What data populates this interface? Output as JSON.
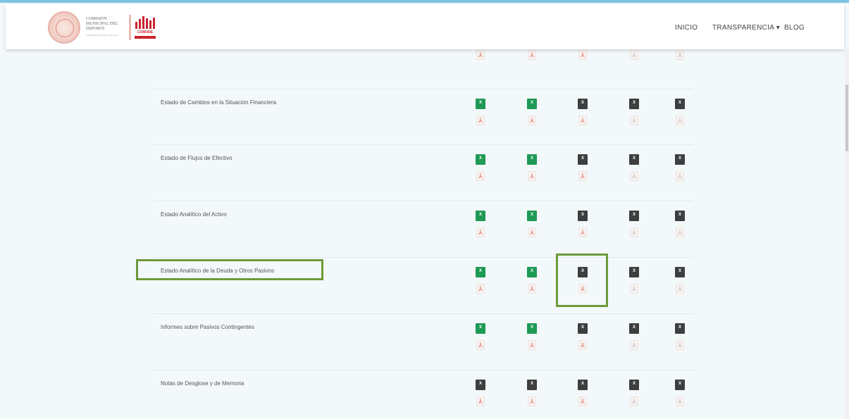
{
  "header": {
    "org_name_lines": [
      "COMISIÓN",
      "MUNICIPAL DEL",
      "DEPORTE"
    ],
    "org_subtitle": "GOBIERNO MUNICIPAL 2024-2027",
    "brand_text": "COMUDE",
    "nav": [
      {
        "label": "INICIO"
      },
      {
        "label": "TRANSPARENCIA ▾"
      },
      {
        "label": "BLOG"
      }
    ]
  },
  "icons": {
    "excel_glyph": "X",
    "pdf_glyph": "⅄"
  },
  "colors": {
    "excel_available": "#1e9a55",
    "excel_unavailable": "#3e3e3e",
    "pdf_available": "#e0574a",
    "pdf_unavailable": "#b4b4b4",
    "highlight": "#6d9a3a"
  },
  "rows": [
    {
      "label": "",
      "excel": [
        "green",
        "green",
        "dark",
        "dark",
        "dark"
      ],
      "pdf": [
        "red",
        "red",
        "red",
        "grey",
        "grey"
      ]
    },
    {
      "label": "Estado de Cambios en la Situación Financiera",
      "excel": [
        "green",
        "green",
        "dark",
        "dark",
        "dark"
      ],
      "pdf": [
        "red",
        "red",
        "red",
        "grey",
        "grey"
      ]
    },
    {
      "label": "Estado de Flujos de Efectivo",
      "excel": [
        "green",
        "green",
        "dark",
        "dark",
        "dark"
      ],
      "pdf": [
        "red",
        "red",
        "red",
        "grey",
        "grey"
      ]
    },
    {
      "label": "Estado Analítico del Activo",
      "excel": [
        "green",
        "green",
        "dark",
        "dark",
        "dark"
      ],
      "pdf": [
        "red",
        "red",
        "red",
        "grey",
        "grey"
      ]
    },
    {
      "label": "Estado Analítico de la Deuda y Otros Pasivos",
      "excel": [
        "green",
        "green",
        "dark",
        "dark",
        "dark"
      ],
      "pdf": [
        "red",
        "red",
        "red",
        "grey",
        "grey"
      ]
    },
    {
      "label": "Informes sobre Pasivos Contingentes",
      "excel": [
        "green",
        "green",
        "dark",
        "dark",
        "dark"
      ],
      "pdf": [
        "red",
        "red",
        "red",
        "grey",
        "grey"
      ]
    },
    {
      "label": "Notas de Desglose y de Memoria",
      "excel": [
        "dark",
        "dark",
        "dark",
        "dark",
        "dark"
      ],
      "pdf": [
        "red",
        "red",
        "red",
        "grey",
        "grey"
      ]
    }
  ]
}
